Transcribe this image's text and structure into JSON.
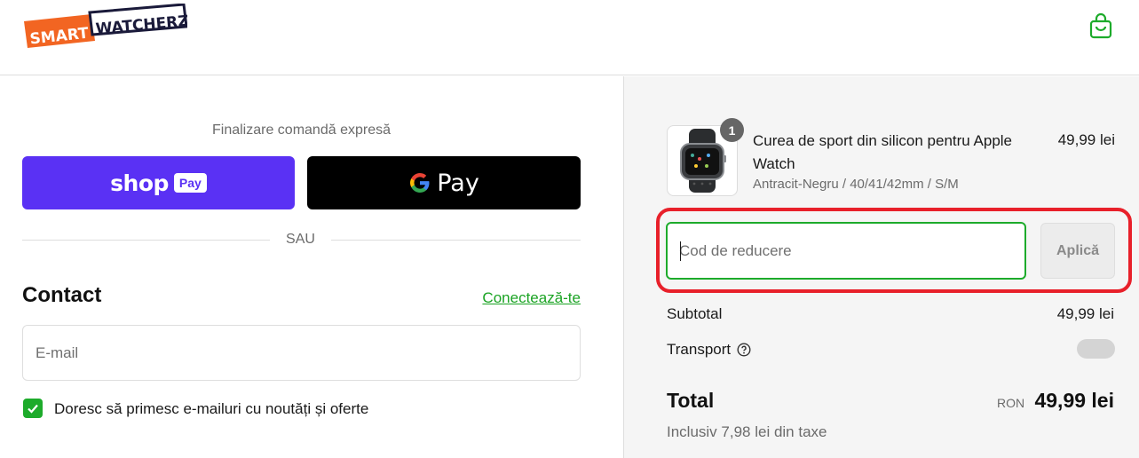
{
  "header": {
    "logo_text_1": "SMART",
    "logo_text_2": "WATCHERZ",
    "cart_icon": "shopping-bag-icon"
  },
  "colors": {
    "brand_orange": "#f26522",
    "accent_green": "#1dab2b",
    "shop_pay_purple": "#5a31f4",
    "highlight_red": "#e8202a"
  },
  "express": {
    "title": "Finalizare comandă expresă",
    "shop_pay_word": "shop",
    "shop_pay_badge": "Pay",
    "gpay_word": "Pay",
    "separator": "SAU"
  },
  "contact": {
    "title": "Contact",
    "login_link": "Conectează-te",
    "email_placeholder": "E-mail",
    "newsletter_label": "Doresc să primesc e-mailuri cu noutăți și oferte",
    "newsletter_checked": true
  },
  "order": {
    "item": {
      "name": "Curea de sport din silicon pentru Apple Watch",
      "variant": "Antracit-Negru / 40/41/42mm / S/M",
      "price": "49,99 lei",
      "quantity": "1"
    },
    "discount_placeholder": "Cod de reducere",
    "apply_label": "Aplică",
    "subtotal_label": "Subtotal",
    "subtotal_value": "49,99 lei",
    "shipping_label": "Transport",
    "total_label": "Total",
    "currency": "RON",
    "total_value": "49,99 lei",
    "tax_note": "Inclusiv 7,98 lei din taxe"
  }
}
